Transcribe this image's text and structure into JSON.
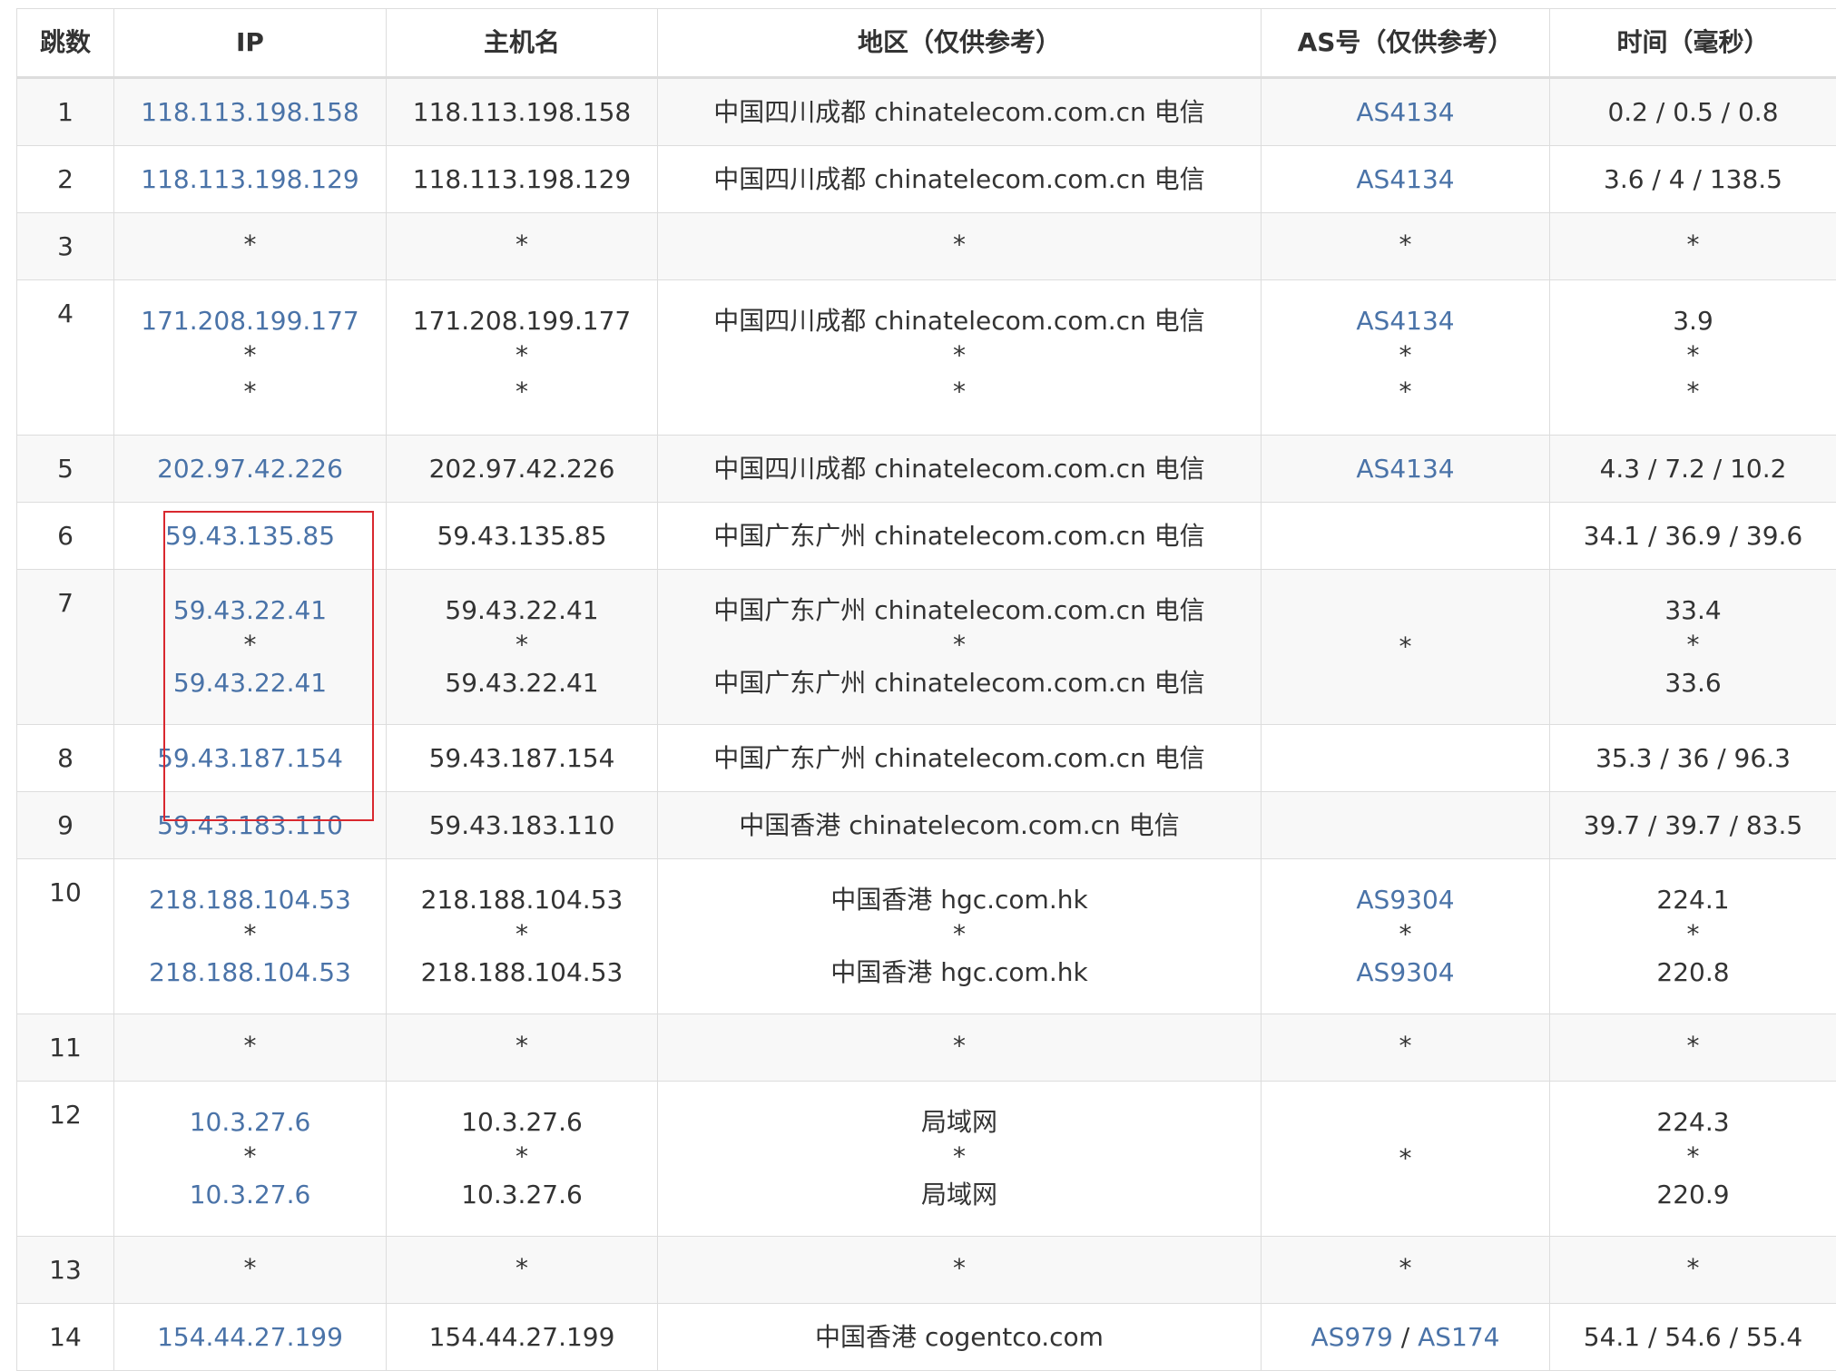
{
  "table": {
    "headers": [
      "跳数",
      "IP",
      "主机名",
      "地区（仅供参考）",
      "AS号（仅供参考）",
      "时间（毫秒）"
    ],
    "rows": [
      {
        "hop": "1",
        "lines": [
          {
            "ip": "118.113.198.158",
            "host": "118.113.198.158",
            "region": "中国四川成都 chinatelecom.com.cn 电信",
            "as": [
              "AS4134"
            ],
            "time": "0.2 / 0.5 / 0.8"
          }
        ]
      },
      {
        "hop": "2",
        "lines": [
          {
            "ip": "118.113.198.129",
            "host": "118.113.198.129",
            "region": "中国四川成都 chinatelecom.com.cn 电信",
            "as": [
              "AS4134"
            ],
            "time": "3.6 / 4 / 138.5"
          }
        ]
      },
      {
        "hop": "3",
        "lines": [
          {
            "ip": "*",
            "host": "*",
            "region": "*",
            "as": [
              "*"
            ],
            "time": "*"
          }
        ]
      },
      {
        "hop": "4",
        "lines": [
          {
            "ip": "171.208.199.177",
            "host": "171.208.199.177",
            "region": "中国四川成都 chinatelecom.com.cn 电信",
            "as": [
              "AS4134"
            ],
            "time": "3.9"
          },
          {
            "ip": "*",
            "host": "*",
            "region": "*",
            "as": [
              "*"
            ],
            "time": "*"
          },
          {
            "ip": "*",
            "host": "*",
            "region": "*",
            "as": [
              "*"
            ],
            "time": "*"
          }
        ]
      },
      {
        "hop": "5",
        "lines": [
          {
            "ip": "202.97.42.226",
            "host": "202.97.42.226",
            "region": "中国四川成都 chinatelecom.com.cn 电信",
            "as": [
              "AS4134"
            ],
            "time": "4.3 / 7.2 / 10.2"
          }
        ]
      },
      {
        "hop": "6",
        "lines": [
          {
            "ip": "59.43.135.85",
            "host": "59.43.135.85",
            "region": "中国广东广州 chinatelecom.com.cn 电信",
            "as": [],
            "time": "34.1 / 36.9 / 39.6"
          }
        ]
      },
      {
        "hop": "7",
        "as_merged": "*",
        "lines": [
          {
            "ip": "59.43.22.41",
            "host": "59.43.22.41",
            "region": "中国广东广州 chinatelecom.com.cn 电信",
            "time": "33.4"
          },
          {
            "ip": "*",
            "host": "*",
            "region": "*",
            "time": "*"
          },
          {
            "ip": "59.43.22.41",
            "host": "59.43.22.41",
            "region": "中国广东广州 chinatelecom.com.cn 电信",
            "time": "33.6"
          }
        ]
      },
      {
        "hop": "8",
        "lines": [
          {
            "ip": "59.43.187.154",
            "host": "59.43.187.154",
            "region": "中国广东广州 chinatelecom.com.cn 电信",
            "as": [],
            "time": "35.3 / 36 / 96.3"
          }
        ]
      },
      {
        "hop": "9",
        "lines": [
          {
            "ip": "59.43.183.110",
            "host": "59.43.183.110",
            "region": "中国香港 chinatelecom.com.cn 电信",
            "as": [],
            "time": "39.7 / 39.7 / 83.5"
          }
        ]
      },
      {
        "hop": "10",
        "lines": [
          {
            "ip": "218.188.104.53",
            "host": "218.188.104.53",
            "region": "中国香港 hgc.com.hk",
            "as": [
              "AS9304"
            ],
            "time": "224.1"
          },
          {
            "ip": "*",
            "host": "*",
            "region": "*",
            "as": [
              "*"
            ],
            "time": "*"
          },
          {
            "ip": "218.188.104.53",
            "host": "218.188.104.53",
            "region": "中国香港 hgc.com.hk",
            "as": [
              "AS9304"
            ],
            "time": "220.8"
          }
        ]
      },
      {
        "hop": "11",
        "lines": [
          {
            "ip": "*",
            "host": "*",
            "region": "*",
            "as": [
              "*"
            ],
            "time": "*"
          }
        ]
      },
      {
        "hop": "12",
        "as_merged": "*",
        "lines": [
          {
            "ip": "10.3.27.6",
            "host": "10.3.27.6",
            "region": "局域网",
            "time": "224.3"
          },
          {
            "ip": "*",
            "host": "*",
            "region": "*",
            "time": "*"
          },
          {
            "ip": "10.3.27.6",
            "host": "10.3.27.6",
            "region": "局域网",
            "time": "220.9"
          }
        ]
      },
      {
        "hop": "13",
        "lines": [
          {
            "ip": "*",
            "host": "*",
            "region": "*",
            "as": [
              "*"
            ],
            "time": "*"
          }
        ]
      },
      {
        "hop": "14",
        "lines": [
          {
            "ip": "154.44.27.199",
            "host": "154.44.27.199",
            "region": "中国香港 cogentco.com",
            "as": [
              "AS979",
              "AS174"
            ],
            "time": "54.1 / 54.6 / 55.4"
          }
        ]
      }
    ]
  },
  "colors": {
    "link": "#4a73a8",
    "border": "#dddddd",
    "row_shade": "#f8f8f8",
    "highlight": "#d9282f"
  }
}
